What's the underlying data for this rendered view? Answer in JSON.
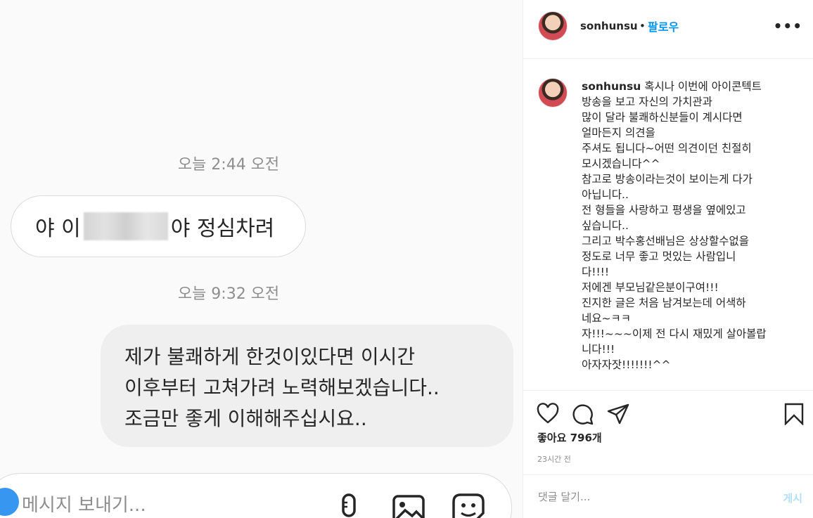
{
  "chat": {
    "timestamp_1": "오늘 2:44 오전",
    "incoming_message": {
      "before": "야 이",
      "after": "야 정심차려"
    },
    "timestamp_2": "오늘 9:32 오전",
    "outgoing_message_lines": [
      "제가 불쾌하게 한것이있다면 이시간",
      "이후부터 고쳐가려 노력해보겠습니다..",
      "조금만 좋게 이해해주십시요.."
    ],
    "composer_placeholder": "메시지 보내기..."
  },
  "post": {
    "username": "sonhunsu",
    "separator": "•",
    "follow_label": "팔로우",
    "more_label": "•••",
    "caption_lines": [
      "혹시나 이번에 아이콘텍트",
      "방송을 보고 자신의 가치관과",
      "많이 달라 불쾌하신분들이 계시다면",
      "얼마든지 의견을",
      "주셔도 됩니다~어떤 의견이던 친절히",
      "모시겠습니다^^",
      "참고로 방송이라는것이 보이는게 다가",
      "아닙니다..",
      "전 형들을 사랑하고 평생을 옆에있고",
      "싶습니다..",
      "그리고 박수홍선배님은 상상할수없을",
      "정도로 너무 좋고 멋있는 사람입니",
      "다!!!!",
      "저에겐 부모님같은분이구여!!!",
      "진지한 글은 처음 남겨보는데 어색하",
      "네요~ㅋㅋ",
      "자!!!~~~이제 전 다시 재밌게 살아볼랍",
      "니다!!!",
      "아자자잣!!!!!!!^^"
    ],
    "likes_label": "좋아요 796개",
    "time_ago": "23시간 전",
    "comment_placeholder": "댓글 달기...",
    "post_button": "게시",
    "accent_color": "#0095f6"
  }
}
